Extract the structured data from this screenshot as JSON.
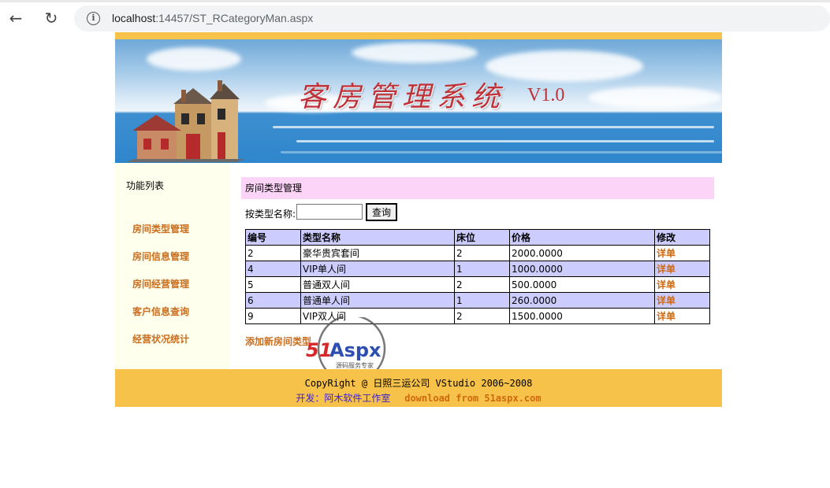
{
  "browser": {
    "url_host": "localhost",
    "url_rest": ":14457/ST_RCategoryMan.aspx"
  },
  "banner": {
    "title": "客房管理系统",
    "version": "V1.0"
  },
  "sidebar": {
    "title": "功能列表",
    "items": [
      {
        "label": "房间类型管理"
      },
      {
        "label": "房间信息管理"
      },
      {
        "label": "房间经营管理"
      },
      {
        "label": "客户信息查询"
      },
      {
        "label": "经营状况统计"
      }
    ]
  },
  "main": {
    "section_title": "房间类型管理",
    "search_label": "按类型名称:",
    "search_value": "",
    "search_button": "查询",
    "table": {
      "headers": [
        "编号",
        "类型名称",
        "床位",
        "价格",
        "修改"
      ],
      "rows": [
        {
          "id": "2",
          "name": "豪华贵宾套间",
          "beds": "2",
          "price": "2000.0000",
          "action": "详单"
        },
        {
          "id": "4",
          "name": "VIP单人间",
          "beds": "1",
          "price": "1000.0000",
          "action": "详单"
        },
        {
          "id": "5",
          "name": "普通双人间",
          "beds": "2",
          "price": "500.0000",
          "action": "详单"
        },
        {
          "id": "6",
          "name": "普通单人间",
          "beds": "1",
          "price": "260.0000",
          "action": "详单"
        },
        {
          "id": "9",
          "name": "VIP双人间",
          "beds": "2",
          "price": "1500.0000",
          "action": "详单"
        }
      ]
    },
    "add_link": "添加新房间类型"
  },
  "watermark": {
    "brand_51": "51",
    "brand_aspx": "Aspx",
    "tagline": "源码服务专家"
  },
  "footer": {
    "copyright": "CopyRight @ 日照三运公司 VStudio 2006~2008",
    "developer": "开发：阿木软件工作室",
    "download": "download from 51aspx.com"
  },
  "colors": {
    "accent_orange": "#f7c24a",
    "link_orange": "#c96d1e",
    "table_header": "#ccccff",
    "section_pink": "#fbd4f8",
    "sidebar_bg": "#ffffee"
  }
}
